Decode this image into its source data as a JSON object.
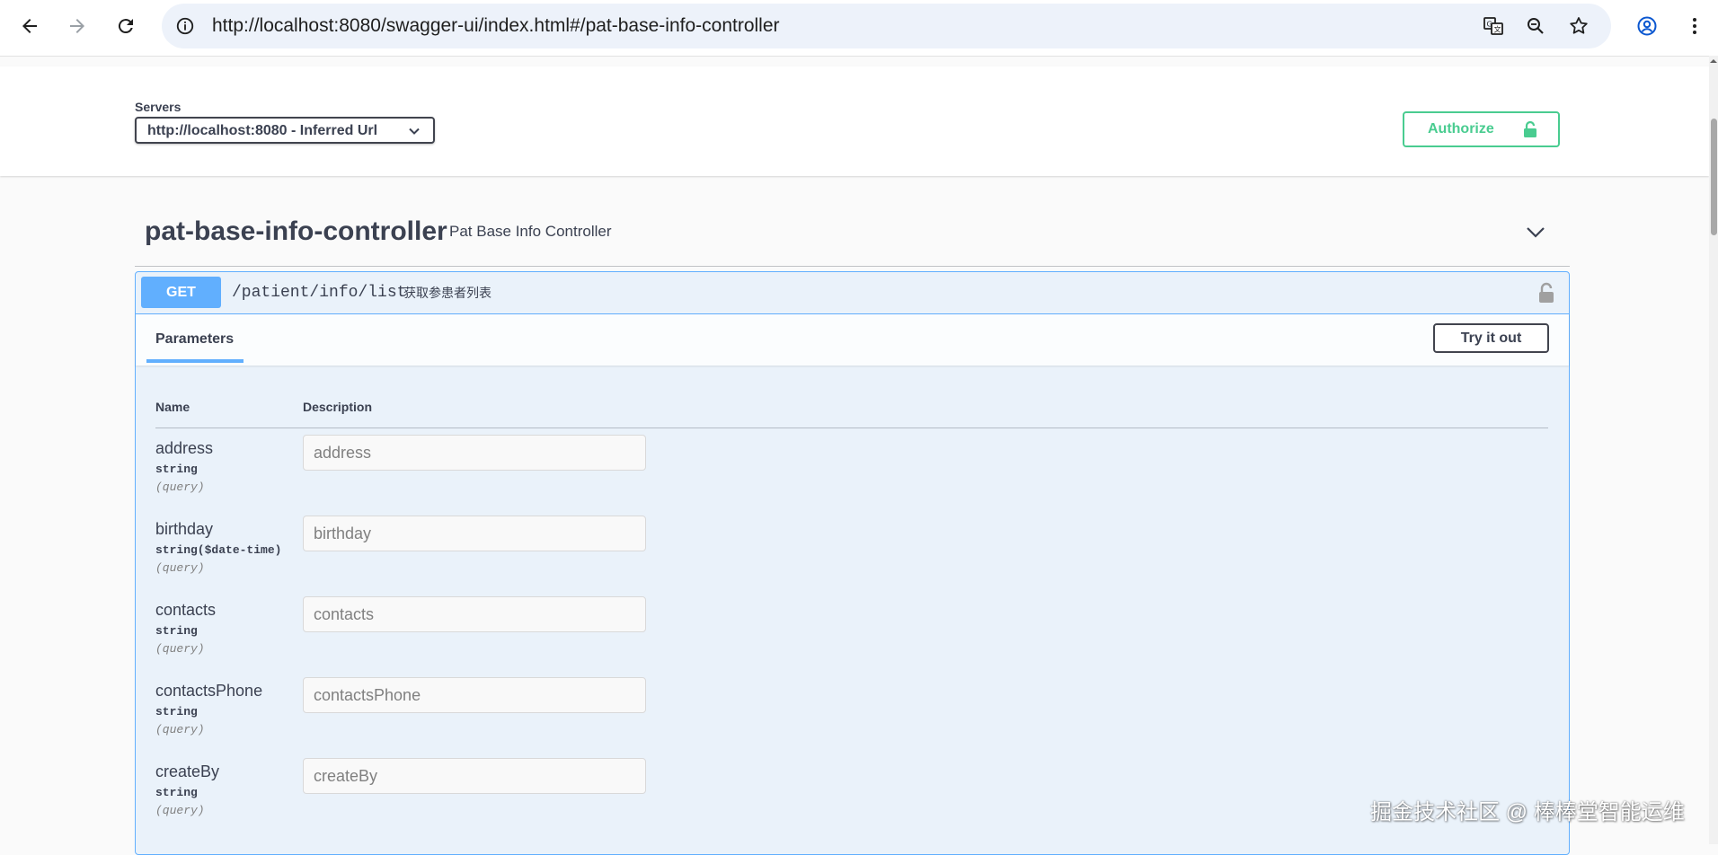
{
  "browser": {
    "url": "http://localhost:8080/swagger-ui/index.html#/pat-base-info-controller",
    "icons": [
      "back-icon",
      "forward-icon",
      "reload-icon",
      "site-info-icon",
      "translate-icon",
      "zoom-icon",
      "star-icon",
      "profile-icon",
      "menu-icon"
    ]
  },
  "servers": {
    "label": "Servers",
    "selected": "http://localhost:8080 - Inferred Url"
  },
  "authorize": {
    "label": "Authorize"
  },
  "tag": {
    "name": "pat-base-info-controller",
    "description": "Pat Base Info Controller"
  },
  "operation": {
    "method": "GET",
    "path": "/patient/info/list",
    "summary": "获取参患者列表",
    "tab": "Parameters",
    "try_label": "Try it out",
    "columns": {
      "name": "Name",
      "description": "Description"
    },
    "params": [
      {
        "name": "address",
        "type": "string",
        "in": "(query)",
        "placeholder": "address"
      },
      {
        "name": "birthday",
        "type": "string($date-time)",
        "in": "(query)",
        "placeholder": "birthday"
      },
      {
        "name": "contacts",
        "type": "string",
        "in": "(query)",
        "placeholder": "contacts"
      },
      {
        "name": "contactsPhone",
        "type": "string",
        "in": "(query)",
        "placeholder": "contactsPhone"
      },
      {
        "name": "createBy",
        "type": "string",
        "in": "(query)",
        "placeholder": "createBy"
      }
    ]
  },
  "colors": {
    "get": "#61affe",
    "authorize": "#49cc90"
  },
  "watermark": "掘金技术社区 @ 棒棒堂智能运维"
}
